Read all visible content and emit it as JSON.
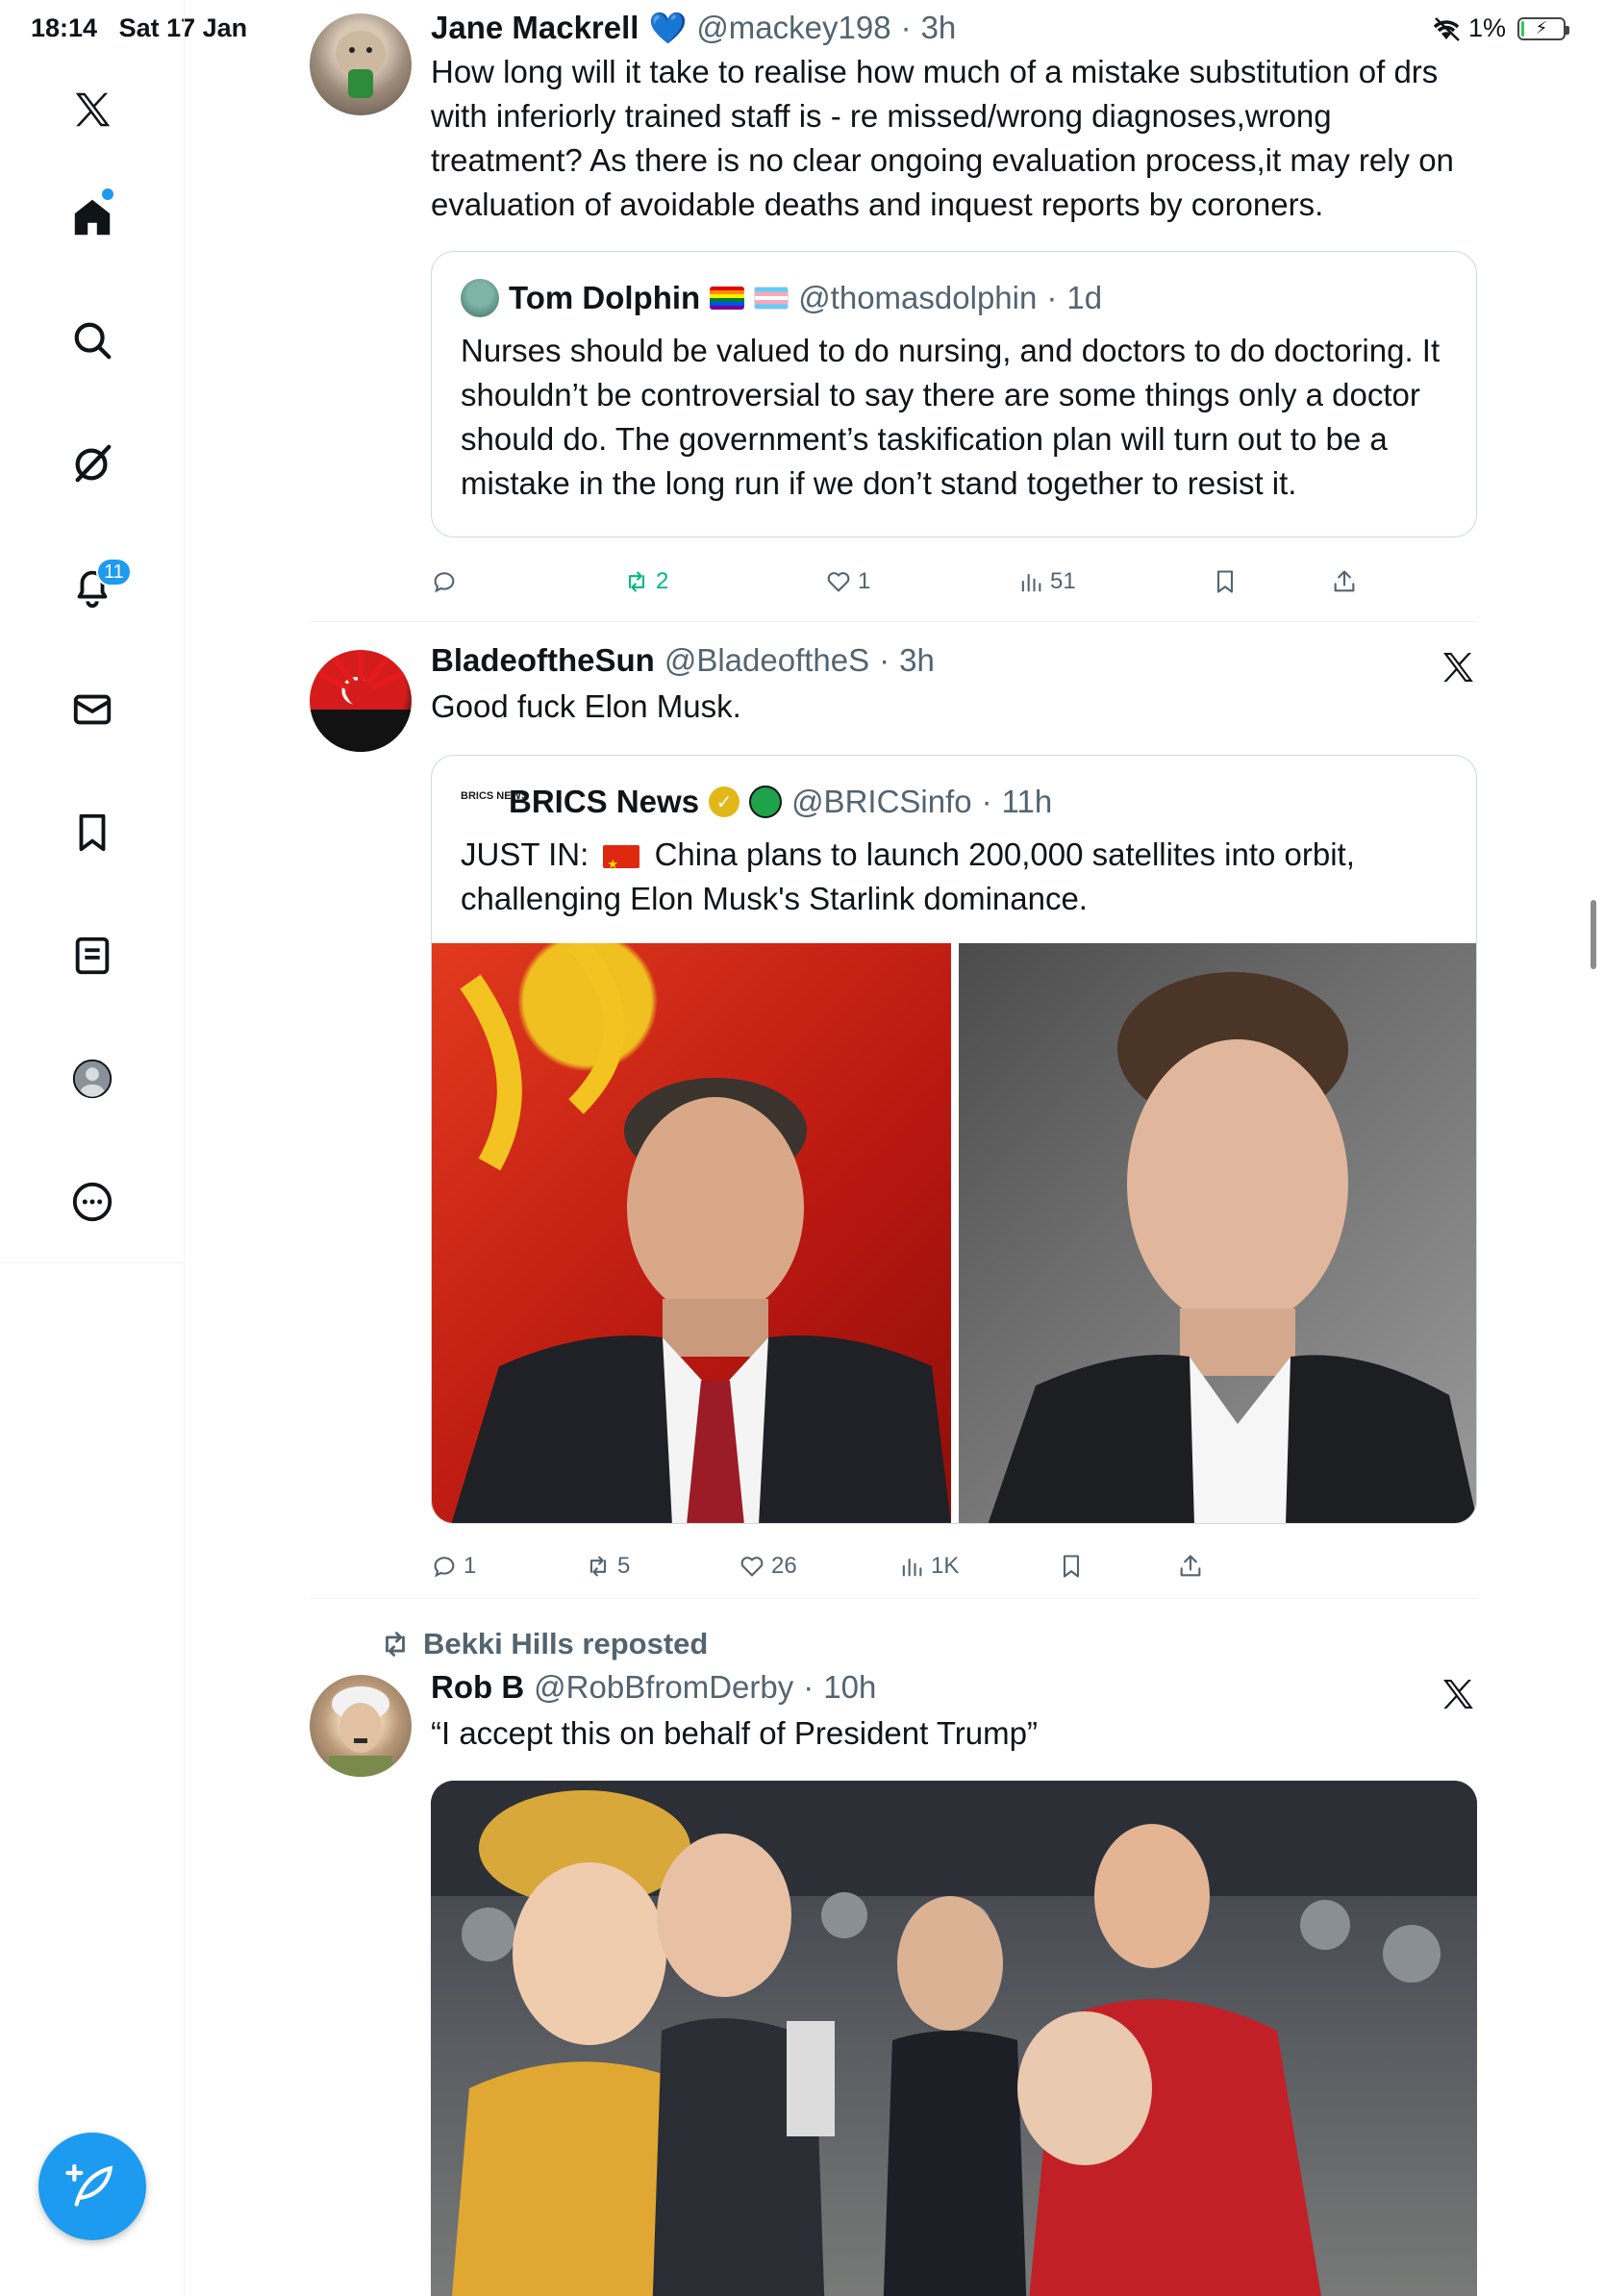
{
  "status_bar": {
    "time": "18:14",
    "date": "Sat 17 Jan",
    "battery": "1%",
    "battery_level": 0.01
  },
  "sidebar": {
    "notifications_count": "11",
    "items": [
      {
        "name": "x-logo-icon"
      },
      {
        "name": "home-icon"
      },
      {
        "name": "search-icon"
      },
      {
        "name": "grok-icon"
      },
      {
        "name": "notifications-icon"
      },
      {
        "name": "messages-icon"
      },
      {
        "name": "bookmarks-icon"
      },
      {
        "name": "lists-icon"
      },
      {
        "name": "profile-icon"
      },
      {
        "name": "more-icon"
      }
    ],
    "compose_icon": "compose-feather-icon"
  },
  "colors": {
    "accent": "#1d9bf0",
    "retweet_active": "#00ba7c",
    "secondary_text": "#536471",
    "border": "#cfd9de"
  },
  "tweets": [
    {
      "display_name": "Jane Mackrell",
      "handle": "@mackey198",
      "sep": "·",
      "time": "3h",
      "text": "How long will it take to realise how much of a mistake substitution of drs with inferiorly trained staff is - re missed/wrong diagnoses,wrong treatment? As there is no clear ongoing  evaluation process,it may rely on evaluation of avoidable deaths and inquest reports by coroners.",
      "quote": {
        "display_name": "Tom Dolphin",
        "handle": "@thomasdolphin",
        "sep": "·",
        "time": "1d",
        "text": "Nurses should be valued to do nursing, and doctors to do doctoring. It shouldn’t be controversial to say there are some things only a doctor should do. The government’s taskification plan will turn out to be a mistake in the long run if we don’t stand together to resist it."
      },
      "actions": {
        "replies": "",
        "reposts": "2",
        "likes": "1",
        "views": "51"
      }
    },
    {
      "display_name": "BladeoftheSun",
      "handle": "@BladeoftheS",
      "sep": "·",
      "time": "3h",
      "text": "Good fuck Elon Musk.",
      "quote": {
        "avatar_text": "BRICS NEWS",
        "display_name": "BRICS News",
        "handle": "@BRICSinfo",
        "sep": "·",
        "time": "11h",
        "text_prefix": "JUST IN:",
        "text": "China plans to launch 200,000 satellites into orbit, challenging Elon Musk's Starlink dominance."
      },
      "actions": {
        "replies": "1",
        "reposts": "5",
        "likes": "26",
        "views": "1K"
      }
    },
    {
      "reposted_by": "Bekki Hills reposted",
      "display_name": "Rob B",
      "handle": "@RobBfromDerby",
      "sep": "·",
      "time": "10h",
      "text": "“I accept this on behalf of President Trump”"
    }
  ]
}
